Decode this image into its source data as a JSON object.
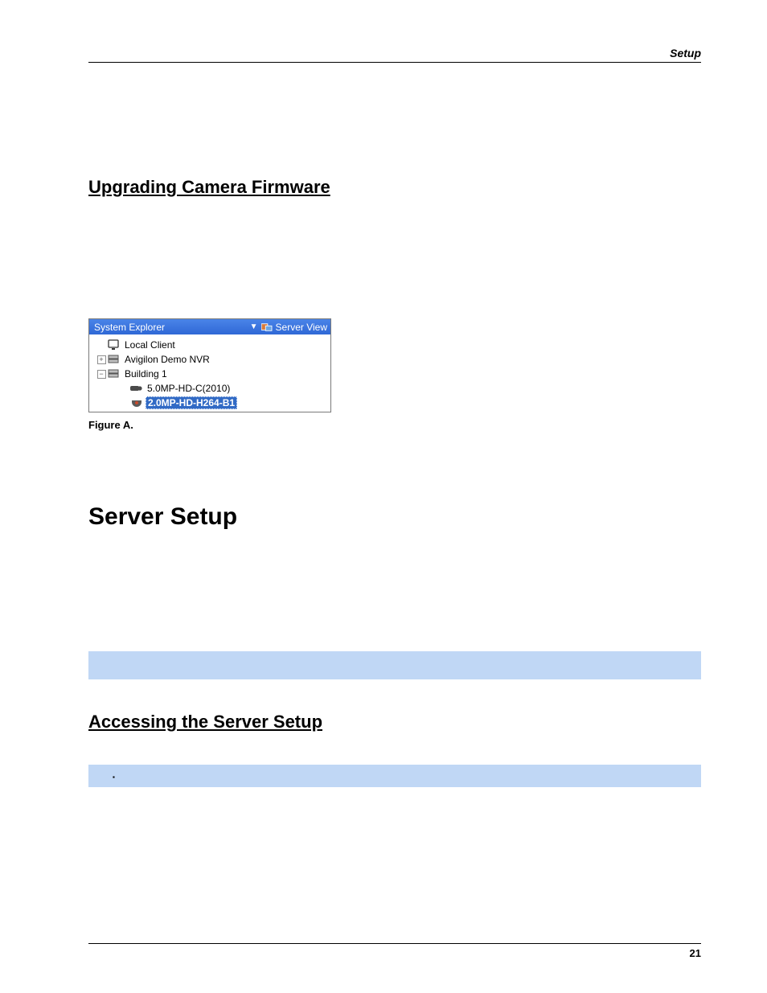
{
  "header": {
    "section_label": "Setup"
  },
  "heading_upgrade": "Upgrading Camera Firmware",
  "tree": {
    "title": "System Explorer",
    "server_view_label": "Server View",
    "local_client": "Local Client",
    "avigilon_demo": "Avigilon Demo NVR",
    "building1": "Building 1",
    "cam1": "5.0MP-HD-C(2010)",
    "cam2_selected": "2.0MP-HD-H264-B1"
  },
  "figure_caption": "Figure A.",
  "heading_server_setup": "Server Setup",
  "heading_access": "Accessing the Server Setup",
  "bullets": {
    "item1": "",
    "item2": ""
  },
  "page_number": "21"
}
